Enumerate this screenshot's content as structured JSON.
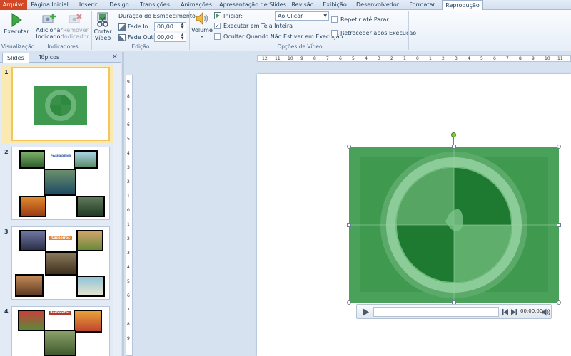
{
  "tabs": [
    "Arquivo",
    "Página Inicial",
    "Inserir",
    "Design",
    "Transições",
    "Animações",
    "Apresentação de Slides",
    "Revisão",
    "Exibição",
    "Desenvolvedor",
    "Formatar",
    "Reprodução"
  ],
  "ribbon": {
    "preview": {
      "play_label": "Executar",
      "group": "Visualização"
    },
    "bookmarks": {
      "add_label": "Adicionar Indicador",
      "remove_label": "Remover Indicador",
      "group": "Indicadores"
    },
    "editing": {
      "trim_label": "Cortar Vídeo",
      "fade_title": "Duração do Esmaecimento",
      "fade_in_label": "Fade In:",
      "fade_in_value": "00,00",
      "fade_out_label": "Fade Out:",
      "fade_out_value": "00,00",
      "group": "Edição"
    },
    "video_options": {
      "volume_label": "Volume",
      "start_label": "Iniciar:",
      "start_value": "Ao Clicar",
      "fullscreen_label": "Executar em Tela Inteira",
      "fullscreen_checked": true,
      "hide_label": "Ocultar Quando Não Estiver em Execução",
      "loop_label": "Repetir até Parar",
      "rewind_label": "Retroceder após Execução",
      "group": "Opções de Vídeo"
    }
  },
  "panel": {
    "tab_slides": "Slides",
    "tab_outline": "Tópicos",
    "close": "×",
    "thumbs": [
      {
        "num": "1"
      },
      {
        "num": "2",
        "title": "PAISAGENS"
      },
      {
        "num": "3",
        "title": "Cachorros"
      },
      {
        "num": "4",
        "title": "Borboletas"
      }
    ]
  },
  "ruler": {
    "h_labels": [
      "12",
      "11",
      "10",
      "9",
      "8",
      "7",
      "6",
      "5",
      "4",
      "3",
      "2",
      "1",
      "0",
      "1",
      "2",
      "3",
      "4",
      "5",
      "6",
      "7",
      "8",
      "9",
      "10",
      "11",
      "12"
    ],
    "v_labels": [
      "9",
      "8",
      "7",
      "6",
      "5",
      "4",
      "3",
      "2",
      "1",
      "0",
      "1",
      "2",
      "3",
      "4",
      "5",
      "6",
      "7",
      "8",
      "9"
    ]
  },
  "player": {
    "time": "00:00,00"
  },
  "colors": {
    "accent_file_tab": "#d24726",
    "ribbon_bg": "#e6eef8",
    "video_green": "#3f9a50"
  }
}
